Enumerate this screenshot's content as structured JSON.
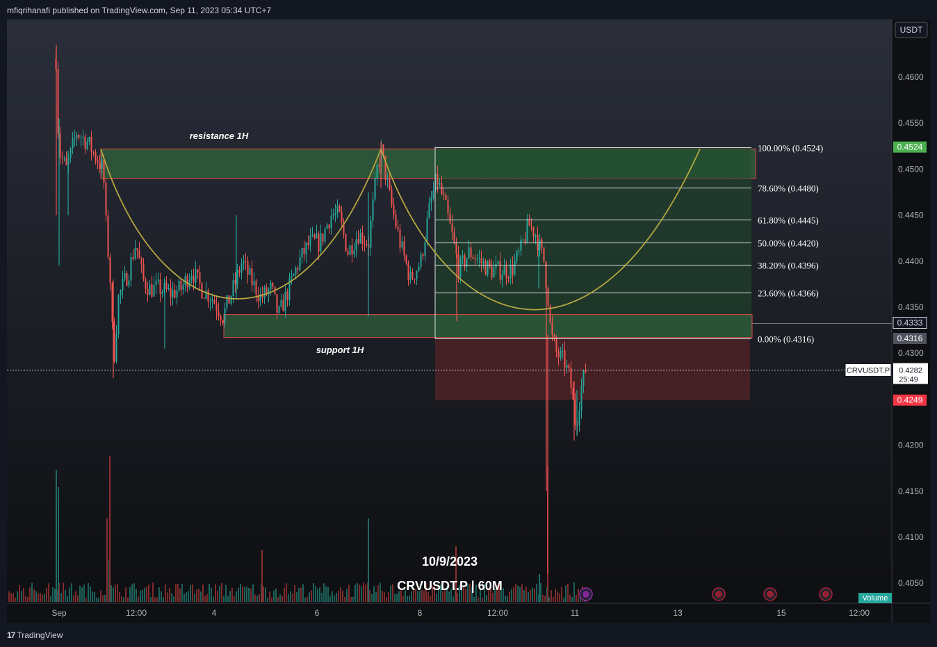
{
  "header": {
    "published": "mfiqrihanafi published on TradingView.com, Sep 11, 2023 05:34 UTC+7"
  },
  "footer": {
    "logo_text": "TradingView",
    "logo_mark": "17"
  },
  "currency_label": "USDT",
  "volume_label": "Volume",
  "watermark": {
    "date": "10/9/2023",
    "symbol": "CRVUSDT.P | 60M"
  },
  "zones": {
    "resistance": "resistance 1H",
    "support": "support 1H"
  },
  "colors": {
    "up": "#26a69a",
    "down": "#ef5350",
    "background": "#131722",
    "curve": "#b5a642",
    "zone_green": "#2e5a3a",
    "zone_red": "#4a2226"
  },
  "chart_data": {
    "type": "candlestick",
    "symbol": "CRVUSDT.P",
    "timeframe": "60M",
    "ylim": [
      0.4015,
      0.466
    ],
    "y_ticks": [
      "0.4600",
      "0.4550",
      "0.4500",
      "0.4450",
      "0.4400",
      "0.4350",
      "0.4300",
      "0.4250",
      "0.4200",
      "0.4150",
      "0.4100",
      "0.4050"
    ],
    "x_ticks": [
      "Sep",
      "12:00",
      "4",
      "6",
      "8",
      "12:00",
      "11",
      "13",
      "15",
      "12:00"
    ],
    "fibonacci": [
      {
        "label": "100.00% (0.4524)",
        "value": 0.4524
      },
      {
        "label": "78.60% (0.4480)",
        "value": 0.448
      },
      {
        "label": "61.80% (0.4445)",
        "value": 0.4445
      },
      {
        "label": "50.00% (0.4420)",
        "value": 0.442
      },
      {
        "label": "38.20% (0.4396)",
        "value": 0.4396
      },
      {
        "label": "23.60% (0.4366)",
        "value": 0.4366
      },
      {
        "label": "0.00% (0.4316)",
        "value": 0.4316
      }
    ],
    "price_labels": [
      {
        "text": "0.4524",
        "value": 0.4524,
        "bg": "#4caf50",
        "fg": "#ffffff"
      },
      {
        "text": "0.4333",
        "value": 0.4333,
        "bg": "#131722",
        "fg": "#d1d4dc",
        "border": "#d1d4dc"
      },
      {
        "text": "0.4316",
        "value": 0.4316,
        "bg": "#50535e",
        "fg": "#ffffff"
      },
      {
        "text": "0.4249",
        "value": 0.4249,
        "bg": "#f23645",
        "fg": "#ffffff"
      }
    ],
    "current": {
      "symbol": "CRVUSDT.P",
      "price": "0.4282",
      "countdown": "25:49",
      "value": 0.4282
    },
    "resistance_zone": [
      0.449,
      0.4522
    ],
    "support_zone": [
      0.4317,
      0.4342
    ],
    "projection_red_zone": [
      0.4249,
      0.4316
    ]
  }
}
